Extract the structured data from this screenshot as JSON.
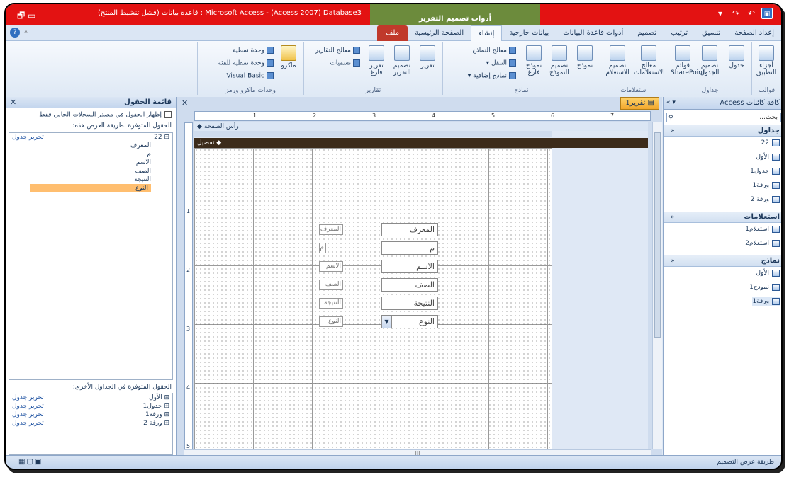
{
  "window": {
    "title": "Microsoft Access - (Access 2007) Database3 : قاعدة بيانات (فشل تنشيط المنتج)",
    "context_tab_group": "أدوات تصميم التقرير"
  },
  "ribbon_tabs": [
    {
      "label": "ملف",
      "state": "file"
    },
    {
      "label": "الصفحة الرئيسية",
      "state": ""
    },
    {
      "label": "إنشاء",
      "state": "active"
    },
    {
      "label": "بيانات خارجية",
      "state": ""
    },
    {
      "label": "أدوات قاعدة البيانات",
      "state": ""
    },
    {
      "label": "تصميم",
      "state": ""
    },
    {
      "label": "ترتيب",
      "state": ""
    },
    {
      "label": "تنسيق",
      "state": ""
    },
    {
      "label": "إعداد الصفحة",
      "state": ""
    }
  ],
  "ribbon_groups": {
    "templates": "قوالب",
    "tables": "جداول",
    "queries": "استعلامات",
    "forms": "نماذج",
    "reports": "تقارير",
    "macros": "وحدات ماكرو ورمز"
  },
  "ribbon_buttons": {
    "app_parts": "أجزاء التطبيق",
    "table": "جدول",
    "table_design": "تصميم الجدول",
    "sharepoint_lists": "قوائم SharePoint",
    "query_wizard": "معالج الاستعلامات",
    "query_design": "تصميم الاستعلام",
    "form": "نموذج",
    "form_design": "تصميم النموذج",
    "blank_form": "نموذج فارغ",
    "form_wizard": "معالج النماذج",
    "navigation": "التنقل",
    "more_forms": "نماذج إضافية",
    "report": "تقرير",
    "report_design": "تصميم التقرير",
    "blank_report": "تقرير فارغ",
    "report_wizard": "معالج التقارير",
    "labels": "تسميات",
    "macro": "ماكرو",
    "module": "وحدة نمطية",
    "class_module": "وحدة نمطية للفئة",
    "visual_basic": "Visual Basic"
  },
  "field_list": {
    "title": "قائمة الحقول",
    "show_only_current": "إظهار الحقول في مصدر السجلات الحالي فقط",
    "available_section": "الحقول المتوفرة لطريقة العرض هذه:",
    "current_table": {
      "name": "22",
      "edit": "تحرير جدول"
    },
    "fields": [
      "المعرف",
      "م",
      "الاسم",
      "الصف",
      "النتيجة",
      "النوع"
    ],
    "selected_field": "النوع",
    "other_section": "الحقول المتوفرة في الجداول الأخرى:",
    "other_tables": [
      {
        "name": "الأول",
        "edit": "تحرير جدول"
      },
      {
        "name": "جدول1",
        "edit": "تحرير جدول"
      },
      {
        "name": "ورقة1",
        "edit": "تحرير جدول"
      },
      {
        "name": "ورقة 2",
        "edit": "تحرير جدول"
      }
    ]
  },
  "document": {
    "tab_label": "تقرير1",
    "page_header": "رأس الصفحة",
    "detail": "تفصيل",
    "ruler_numbers": [
      "1",
      "2",
      "3",
      "4",
      "5",
      "6",
      "7"
    ],
    "vruler_numbers": [
      "1",
      "2",
      "3",
      "4",
      "5"
    ],
    "controls": [
      {
        "label": "المعرف",
        "text": "المعرف",
        "combo": false
      },
      {
        "label": "م",
        "text": "م",
        "combo": false
      },
      {
        "label": "الاسم",
        "text": "الاسم",
        "combo": false
      },
      {
        "label": "الصف",
        "text": "الصف",
        "combo": false
      },
      {
        "label": "النتيجة",
        "text": "النتيجة",
        "combo": false
      },
      {
        "label": "النوع",
        "text": "النوع",
        "combo": true
      }
    ]
  },
  "nav_pane": {
    "title": "كافة كائنات Access",
    "search_placeholder": "بحث...",
    "groups": [
      {
        "name": "جداول",
        "items": [
          "22",
          "الأول",
          "جدول1",
          "ورقة1",
          "ورقة 2"
        ]
      },
      {
        "name": "استعلامات",
        "items": [
          "استعلام1",
          "استعلام2"
        ]
      },
      {
        "name": "نماذج",
        "items": [
          "الأول",
          "نموذج1",
          "ورقة1"
        ]
      }
    ],
    "selected": "ورقة1"
  },
  "status": {
    "text": "طريقة عرض التصميم"
  },
  "colors": {
    "title_bar": "#e31212",
    "context_band": "#6c8b3c",
    "file_tab": "#c0392b",
    "section_bar": "#3c2b1a",
    "selection": "#ffbe6f"
  }
}
